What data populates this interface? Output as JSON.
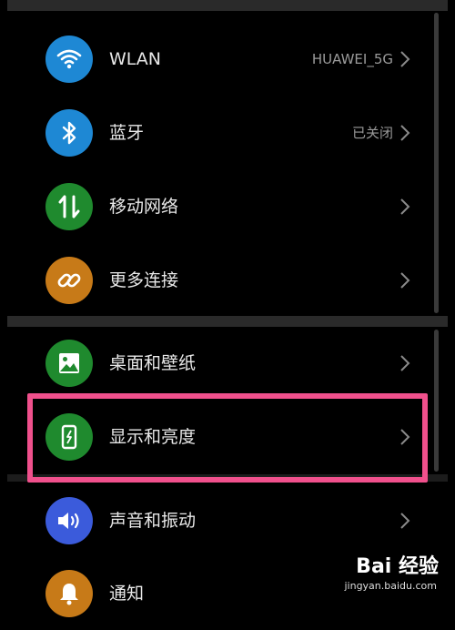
{
  "settings": {
    "items": [
      {
        "label": "WLAN",
        "value": "HUAWEI_5G",
        "icon": "wifi-icon",
        "color": "#1e88d4"
      },
      {
        "label": "蓝牙",
        "value": "已关闭",
        "icon": "bluetooth-icon",
        "color": "#1e88d4"
      },
      {
        "label": "移动网络",
        "value": "",
        "icon": "mobile-data-icon",
        "color": "#1f8a2e"
      },
      {
        "label": "更多连接",
        "value": "",
        "icon": "link-icon",
        "color": "#c77a18"
      },
      {
        "label": "桌面和壁纸",
        "value": "",
        "icon": "wallpaper-icon",
        "color": "#1f8a2e"
      },
      {
        "label": "显示和亮度",
        "value": "",
        "icon": "display-icon",
        "color": "#1f8a2e"
      },
      {
        "label": "声音和振动",
        "value": "",
        "icon": "sound-icon",
        "color": "#3b5bdb"
      },
      {
        "label": "通知",
        "value": "",
        "icon": "notification-icon",
        "color": "#c77a18"
      }
    ]
  },
  "highlight": {
    "color": "#f0508c"
  },
  "watermark": {
    "brand": "Bai 经验",
    "url": "jingyan.baidu.com"
  }
}
